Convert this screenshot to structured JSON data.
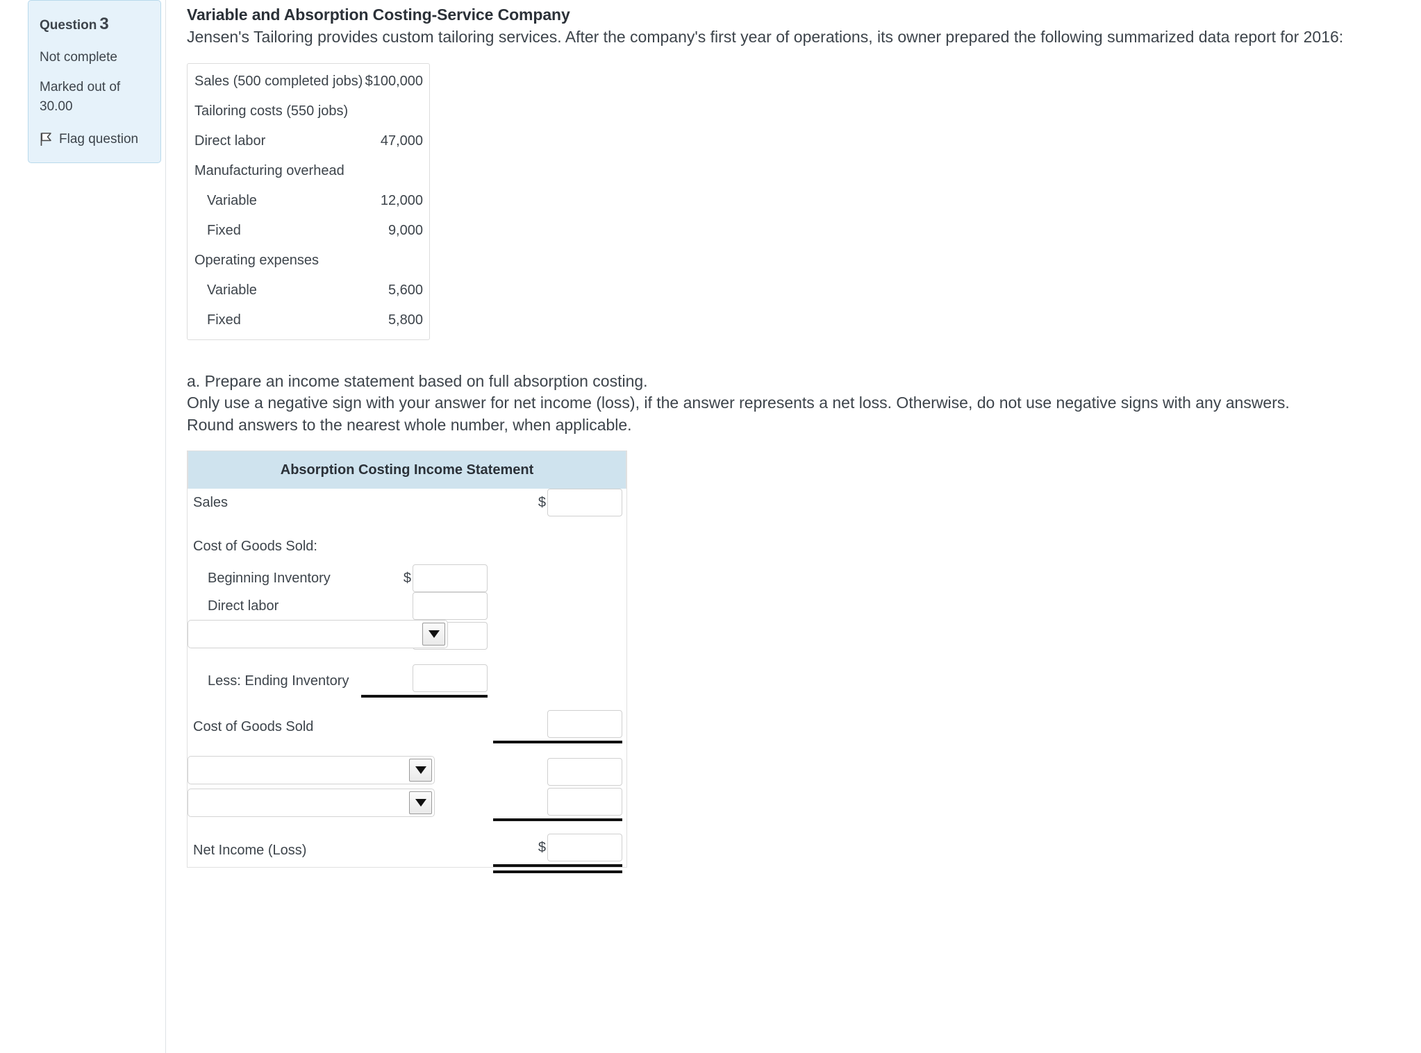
{
  "question_info": {
    "question_label": "Question",
    "question_number": "3",
    "status": "Not complete",
    "marked_out_of": "Marked out of 30.00",
    "flag_label": "Flag question",
    "flag_icon": "flag-icon"
  },
  "question_text": {
    "title": "Variable and Absorption Costing-Service Company",
    "paragraph": "Jensen's Tailoring provides custom tailoring services. After the company's first year of operations, its owner prepared the following summarized data report for 2016:"
  },
  "data_report": {
    "rows": [
      {
        "label": "Sales (500 completed jobs)",
        "value": "$100,000",
        "indent": false
      },
      {
        "label": "Tailoring costs (550 jobs)",
        "value": "",
        "indent": false
      },
      {
        "label": "Direct labor",
        "value": "47,000",
        "indent": false
      },
      {
        "label": "Manufacturing overhead",
        "value": "",
        "indent": false
      },
      {
        "label": "Variable",
        "value": "12,000",
        "indent": true
      },
      {
        "label": "Fixed",
        "value": "9,000",
        "indent": true
      },
      {
        "label": "Operating expenses",
        "value": "",
        "indent": false
      },
      {
        "label": "Variable",
        "value": "5,600",
        "indent": true
      },
      {
        "label": "Fixed",
        "value": "5,800",
        "indent": true
      }
    ]
  },
  "part_a": {
    "line1": "a. Prepare an income statement based on full absorption costing.",
    "line2": "Only use a negative sign with your answer for net income (loss), if the answer represents a net loss. Otherwise, do not use negative signs with any answers.",
    "line3": "Round answers to the nearest whole number, when applicable."
  },
  "statement": {
    "header": "Absorption Costing Income Statement",
    "header_bg": "#cfe3ee",
    "dollar_sign": "$",
    "rows": [
      {
        "kind": "label-right",
        "label": "Sales",
        "right_dollar": true,
        "right_value": "",
        "right_placeholder": ""
      },
      {
        "kind": "label-only",
        "label": "Cost of Goods Sold:"
      },
      {
        "kind": "label-mid",
        "label": "Beginning Inventory",
        "indent": true,
        "mid_dollar": true,
        "mid_value": "",
        "mid_placeholder": ""
      },
      {
        "kind": "label-mid",
        "label": "Direct labor",
        "indent": true,
        "mid_dollar": false,
        "mid_value": "",
        "mid_placeholder": ""
      },
      {
        "kind": "select-mid",
        "select_value": "",
        "select_width": "wide",
        "mid_value": "",
        "mid_placeholder": ""
      },
      {
        "kind": "label-mid",
        "label": "Less: Ending Inventory",
        "indent": true,
        "mid_dollar": false,
        "mid_value": "",
        "mid_placeholder": "",
        "mid_rule": "single"
      },
      {
        "kind": "label-right",
        "label": "Cost of Goods Sold",
        "right_dollar": false,
        "right_value": "",
        "right_placeholder": "",
        "right_rule": "single"
      },
      {
        "kind": "select-right",
        "select_value": "",
        "select_width": "narrow",
        "right_value": "",
        "right_placeholder": ""
      },
      {
        "kind": "select-right",
        "select_value": "",
        "select_width": "narrow",
        "right_value": "",
        "right_placeholder": "",
        "right_rule": "single"
      },
      {
        "kind": "label-right",
        "label": "Net Income (Loss)",
        "right_dollar": true,
        "right_value": "",
        "right_placeholder": "",
        "right_rule": "double"
      }
    ]
  }
}
